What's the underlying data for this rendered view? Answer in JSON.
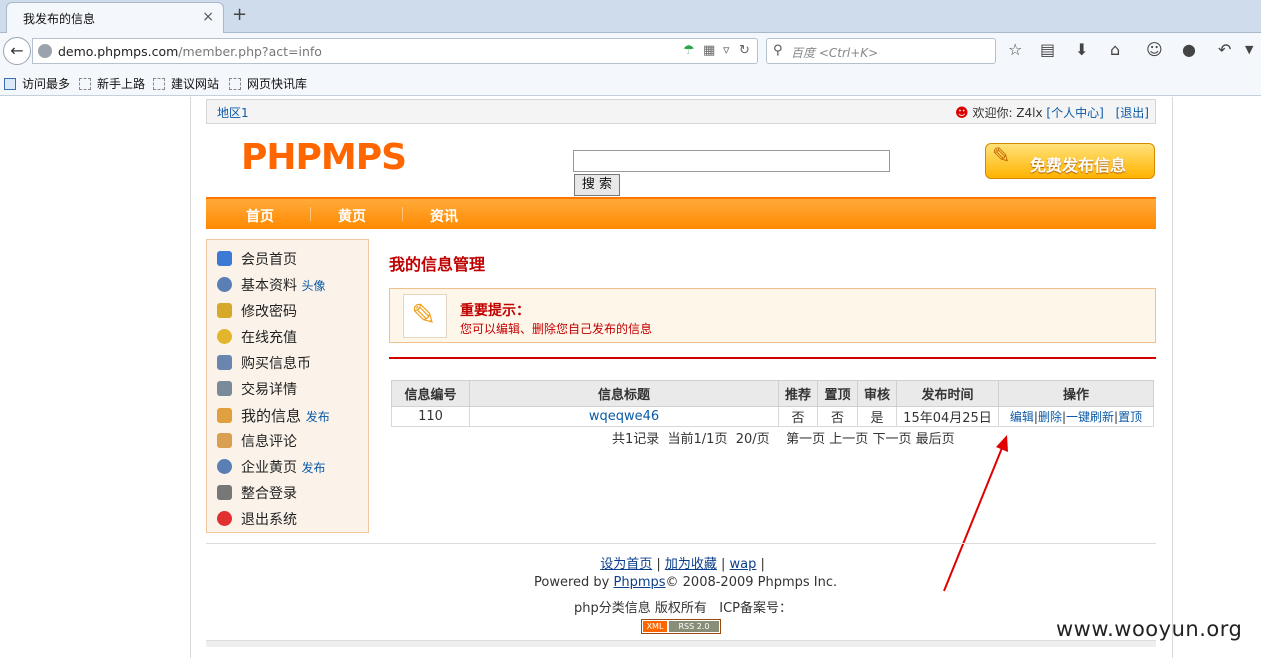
{
  "browser": {
    "tab_title": "我发布的信息",
    "tab_close": "×",
    "new_tab": "+",
    "url_host": "demo.phpmps.com",
    "url_path": "/member.php?act=info",
    "search_placeholder": "百度 <Ctrl+K>",
    "bookmarks": [
      "访问最多",
      "新手上路",
      "建议网站",
      "网页快讯库"
    ]
  },
  "topbar": {
    "area": "地区1",
    "welcome": "欢迎你: Z4lx",
    "user_center": "[个人中心]",
    "logout": "[退出]"
  },
  "header": {
    "logo": "PHPMPS",
    "search_button": "搜 索",
    "post_button": "免费发布信息"
  },
  "nav": [
    "首页",
    "黄页",
    "资讯"
  ],
  "sidebar": {
    "items": [
      {
        "label": "会员首页",
        "sub": "",
        "icon": "home-icon",
        "color": "#3b7bd6"
      },
      {
        "label": "基本资料",
        "sub": "头像",
        "icon": "user-icon",
        "color": "#5a7fb5"
      },
      {
        "label": "修改密码",
        "sub": "",
        "icon": "key-icon",
        "color": "#d6a92a"
      },
      {
        "label": "在线充值",
        "sub": "",
        "icon": "coins-icon",
        "color": "#e3b52a"
      },
      {
        "label": "购买信息币",
        "sub": "",
        "icon": "computer-icon",
        "color": "#6a86b0"
      },
      {
        "label": "交易详情",
        "sub": "",
        "icon": "cart-icon",
        "color": "#7a8a9a"
      },
      {
        "label": "我的信息",
        "sub": "发布",
        "icon": "hand-icon",
        "color": "#e0a040"
      },
      {
        "label": "信息评论",
        "sub": "",
        "icon": "comment-icon",
        "color": "#d8a050"
      },
      {
        "label": "企业黄页",
        "sub": "发布",
        "icon": "user-delete-icon",
        "color": "#5a7fb5"
      },
      {
        "label": "整合登录",
        "sub": "",
        "icon": "printer-icon",
        "color": "#777777"
      },
      {
        "label": "退出系统",
        "sub": "",
        "icon": "exit-icon",
        "color": "#e03030"
      }
    ]
  },
  "main": {
    "title": "我的信息管理",
    "tip_heading": "重要提示：",
    "tip_body": "您可以编辑、删除您自己发布的信息",
    "table": {
      "headers": [
        "信息编号",
        "信息标题",
        "推荐",
        "置顶",
        "审核",
        "发布时间",
        "操作"
      ],
      "rows": [
        {
          "id": "110",
          "title": "wqeqwe46",
          "recommend": "否",
          "top": "否",
          "audit": "是",
          "time": "15年04月25日",
          "ops": [
            "编辑",
            "删除",
            "一键刷新",
            "置顶"
          ]
        }
      ]
    },
    "pager": "共1记录  当前1/1页  20/页    第一页 上一页 下一页 最后页"
  },
  "footer": {
    "links": [
      "设为首页",
      "加为收藏",
      "wap"
    ],
    "powered_prefix": "Powered by ",
    "powered_link": "Phpmps",
    "powered_suffix": "© 2008-2009 Phpmps Inc.",
    "icp": "php分类信息 版权所有   ICP备案号：",
    "rss_left": "XML",
    "rss_right": "RSS 2.0"
  },
  "watermark": "www.wooyun.org",
  "colors": {
    "accent": "#ff8a00",
    "title_red": "#c00000",
    "link": "#0b5aa8"
  }
}
